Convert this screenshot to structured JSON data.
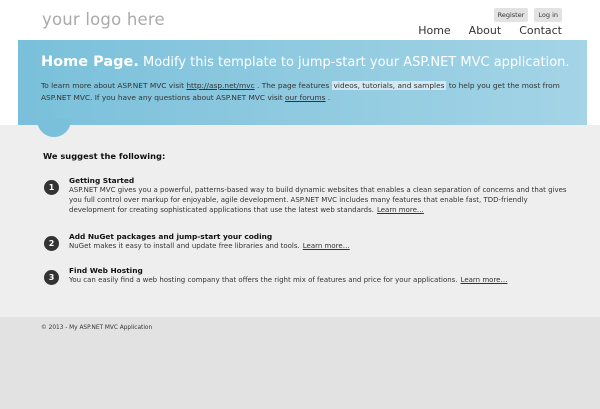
{
  "header": {
    "logo": "your logo here",
    "login": [
      "Register",
      "Log in"
    ],
    "nav": [
      "Home",
      "About",
      "Contact"
    ]
  },
  "featured": {
    "title_bold": "Home Page.",
    "title_rest": " Modify this template to jump-start your ASP.NET MVC application.",
    "text": {
      "p1": "To learn more about ASP.NET MVC visit ",
      "link1": "http://asp.net/mvc",
      "p2": " . The page features ",
      "highlight": "videos, tutorials, and samples",
      "p3": " to help you get the most from ASP.NET MVC. If you have any questions about ASP.NET MVC visit ",
      "link2": "our forums",
      "p4": " ."
    }
  },
  "main": {
    "heading": "We suggest the following:",
    "steps": [
      {
        "number": "1",
        "title": "Getting Started",
        "text": "ASP.NET MVC gives you a powerful, patterns-based way to build dynamic websites that enables a clean separation of concerns and that gives you full control over markup for enjoyable, agile development. ASP.NET MVC includes many features that enable fast, TDD-friendly development for creating sophisticated applications that use the latest web standards.",
        "link": "Learn more…"
      },
      {
        "number": "2",
        "title": "Add NuGet packages and jump-start your coding",
        "text": "NuGet makes it easy to install and update free libraries and tools.",
        "link": "Learn more…"
      },
      {
        "number": "3",
        "title": "Find Web Hosting",
        "text": "You can easily find a web hosting company that offers the right mix of features and price for your applications.",
        "link": "Learn more…"
      }
    ]
  },
  "footer": {
    "copyright": "© 2013 - My ASP.NET MVC Application"
  },
  "colors": {
    "featured_start": "#7ac0da",
    "featured_end": "#a4d4e6",
    "main_bg": "#efeeef",
    "footer_bg": "#e2e2e2"
  }
}
